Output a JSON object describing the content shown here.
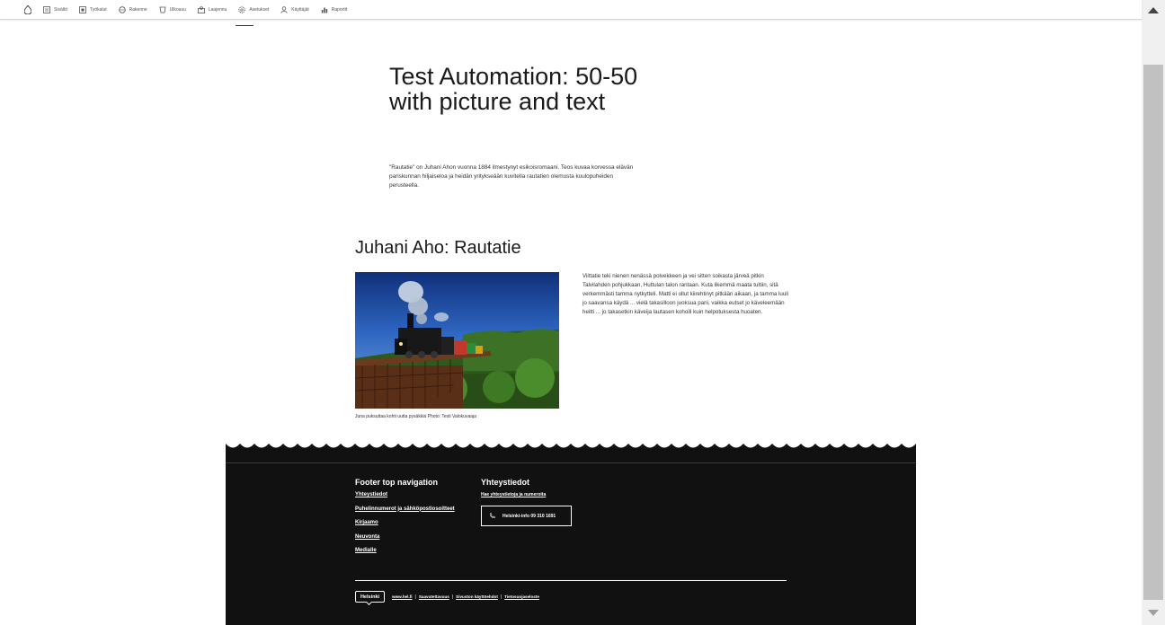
{
  "toolbar": {
    "items": [
      {
        "label": "Sisältö",
        "icon": "content-icon"
      },
      {
        "label": "Työkalut",
        "icon": "tools-icon"
      },
      {
        "label": "Rakenne",
        "icon": "structure-icon"
      },
      {
        "label": "Ulkoasu",
        "icon": "appearance-icon"
      },
      {
        "label": "Laajennu",
        "icon": "extend-icon"
      },
      {
        "label": "Asetukset",
        "icon": "settings-icon"
      },
      {
        "label": "Käyttäjät",
        "icon": "users-icon"
      },
      {
        "label": "Raportit",
        "icon": "reports-icon"
      }
    ]
  },
  "hero": {
    "title": "Test Automation: 50-50 with picture and text",
    "lead": "\"Rautatie\" on Juhani Ahon vuonna 1884 ilmestynyt esikoisromaani. Teos kuvaa korvessa elävän pariskunnan hiljaiseloa ja heidän yritykseään kuvitella rautatien olemusta kuulopuheiden perusteella."
  },
  "section": {
    "title": "Juhani Aho: Rautatie",
    "caption": "Juna puksuttaa kohti uutta pysäkkiä Photo: Testi Valokuvaaja",
    "body": " Viittatie teki nienen nenässä polvekkeen ja vei sitten soikasta järveä pitkin Talvilahden pohjukkaan, Huttulan talon rantaan. Kuta likemmä maata tultiin, sitä verkemmästi tamma nytkytteli. Matti ei ollut kiirehtinyt pitkään aikaan, ja tamma luuli jo saavansa käydä ... vielä takasilloon juoksua pani, vaikka eutset jo käveleemään heitti ... jo takasetkin käveija lautasen kohoili kuin helpotuksesta huoaten."
  },
  "footer": {
    "nav_heading": "Footer top navigation",
    "nav_links": [
      "Yhteystiedot",
      "Puhelinnumerot ja sähköpostiosoitteet",
      "Kirjaamo",
      "Neuvonta",
      "Medialle"
    ],
    "contact_heading": "Yhteystiedot",
    "contact_link": "Hae yhteystietoja ja numeroita",
    "phone_button": "Helsinki-info 09 310 1691",
    "logo_text": "Helsinki",
    "bottom_links": [
      "www.hel.fi",
      "Saavutettavuus",
      "Sivuston käyttöehdot",
      "Tietosuojaseloste"
    ],
    "background": "#111111"
  }
}
